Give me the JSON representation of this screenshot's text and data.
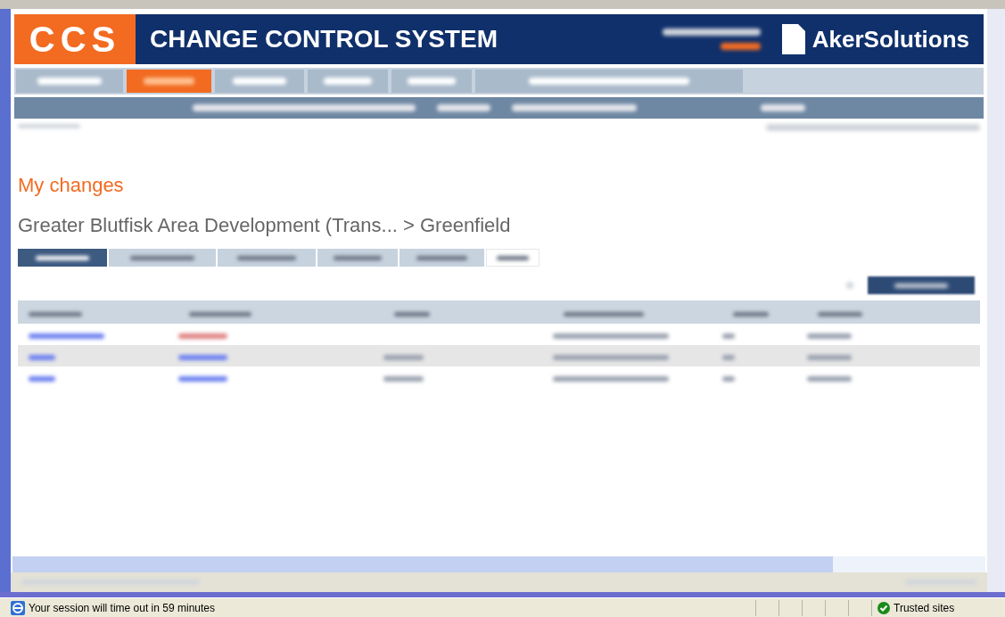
{
  "header": {
    "logo": "CCS",
    "title": "CHANGE CONTROL SYSTEM",
    "brand": "AkerSolutions"
  },
  "nav_tabs": [
    {
      "selected": false
    },
    {
      "selected": true
    },
    {
      "selected": false
    },
    {
      "selected": false
    },
    {
      "selected": false
    },
    {
      "selected": false
    }
  ],
  "page": {
    "heading": "My changes",
    "breadcrumb": "Greater Blutfisk Area Development (Trans... > Greenfield"
  },
  "view_tabs": [
    {
      "selected": true
    },
    {
      "selected": false
    },
    {
      "selected": false
    },
    {
      "selected": false
    },
    {
      "selected": false
    },
    {
      "selected": false
    }
  ],
  "table": {
    "rows": [
      {
        "shaded": false
      },
      {
        "shaded": true
      },
      {
        "shaded": false
      }
    ]
  },
  "status_bar": {
    "message": "Your session will time out in 59 minutes",
    "zone": "Trusted sites"
  }
}
